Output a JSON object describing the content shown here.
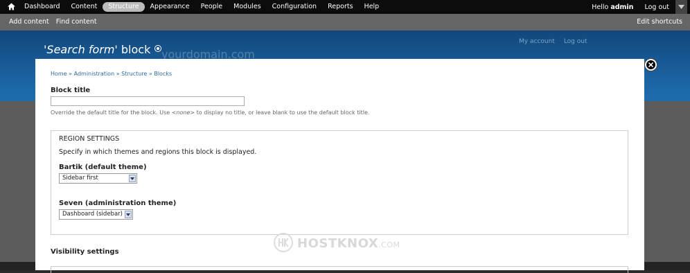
{
  "toolbar": {
    "home_icon": "home-icon",
    "items": [
      {
        "label": "Dashboard"
      },
      {
        "label": "Content"
      },
      {
        "label": "Structure",
        "active": true
      },
      {
        "label": "Appearance"
      },
      {
        "label": "People"
      },
      {
        "label": "Modules"
      },
      {
        "label": "Configuration"
      },
      {
        "label": "Reports"
      },
      {
        "label": "Help"
      }
    ],
    "hello_prefix": "Hello",
    "username": "admin",
    "logout_label": "Log out"
  },
  "shortcuts": {
    "links": [
      {
        "label": "Add content"
      },
      {
        "label": "Find content"
      }
    ],
    "edit_label": "Edit shortcuts"
  },
  "background": {
    "title_quote_open": "'",
    "title_em": "Search form",
    "title_quote_close": "'",
    "title_rest": " block",
    "domain_watermark": "yourdomain.com",
    "links": [
      {
        "label": "My account"
      },
      {
        "label": "Log out"
      }
    ]
  },
  "overlay": {
    "breadcrumb": [
      "Home",
      "Administration",
      "Structure",
      "Blocks"
    ],
    "breadcrumb_sep": " » ",
    "block_title_label": "Block title",
    "block_title_value": "",
    "block_title_desc_pre": "Override the default title for the block. Use ",
    "block_title_desc_em": "<none>",
    "block_title_desc_post": " to display no title, or leave blank to use the default block title.",
    "region": {
      "legend": "REGION SETTINGS",
      "description": "Specify in which themes and regions this block is displayed.",
      "bartik_label": "Bartik (default theme)",
      "bartik_value": "Sidebar first",
      "seven_label": "Seven (administration theme)",
      "seven_value": "Dashboard (sidebar)"
    },
    "visibility_label": "Visibility settings"
  },
  "watermark": {
    "brand": "HOSTKNOX",
    "suffix": ".COM"
  },
  "colors": {
    "toolbar_bg": "#0c0c0c",
    "shortcuts_bg": "#666666",
    "header_blue": "#1c64a3",
    "link_blue": "#2c6a99"
  }
}
